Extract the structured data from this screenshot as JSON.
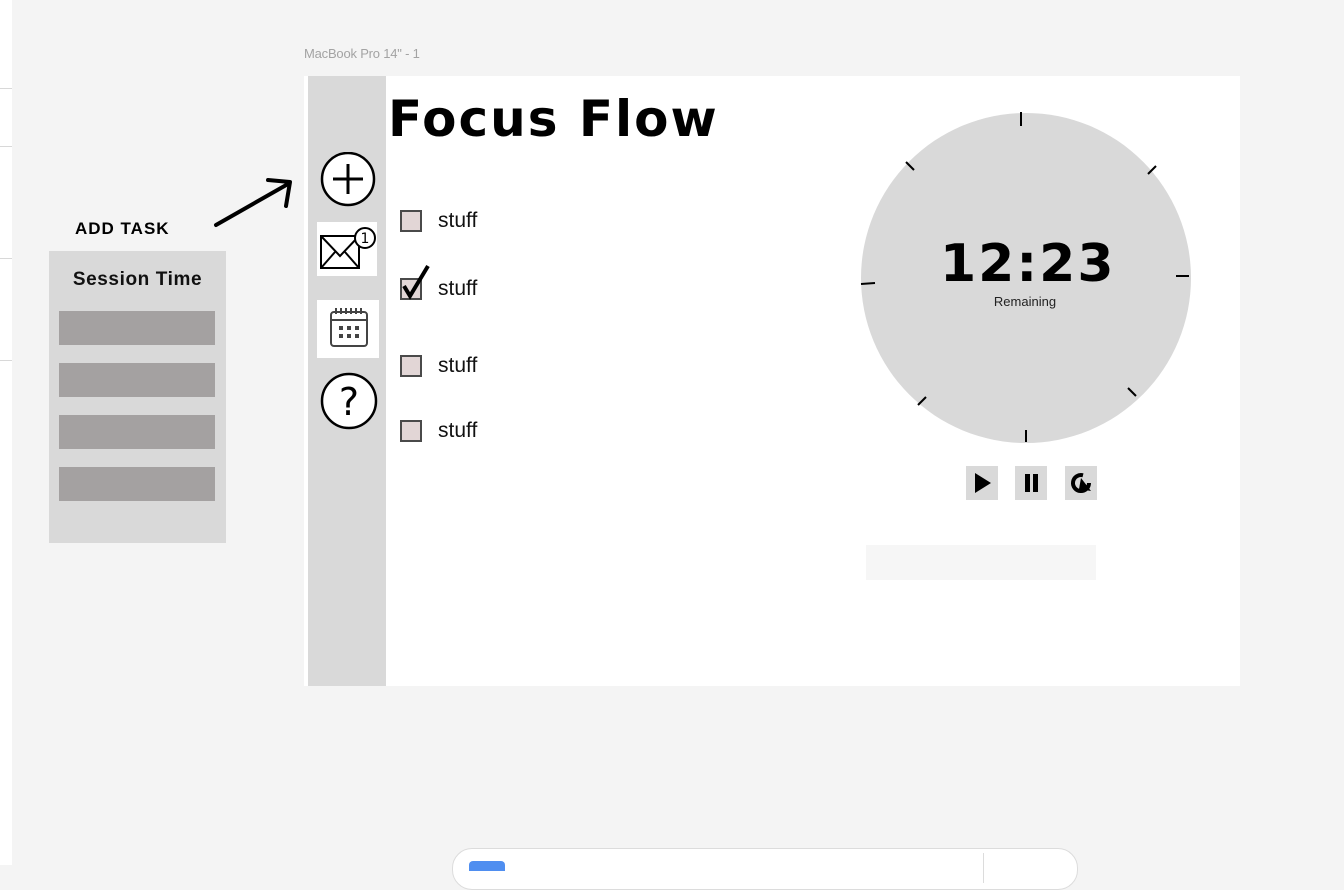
{
  "canvas": {
    "frame_label": "MacBook Pro 14\" - 1"
  },
  "app": {
    "title": "Focus Flow",
    "sidebar": [
      {
        "name": "add-task",
        "icon": "plus-circle-icon"
      },
      {
        "name": "inbox",
        "icon": "mail-icon",
        "badge": "1"
      },
      {
        "name": "calendar",
        "icon": "calendar-icon"
      },
      {
        "name": "help",
        "icon": "question-circle-icon"
      }
    ],
    "tasks": [
      {
        "label": "stuff",
        "checked": false
      },
      {
        "label": "stuff",
        "checked": true
      },
      {
        "label": "stuff",
        "checked": false
      },
      {
        "label": "stuff",
        "checked": false
      }
    ],
    "timer": {
      "time": "12:23",
      "subtitle": "Remaining",
      "controls": [
        "play-icon",
        "pause-icon",
        "restart-icon"
      ]
    }
  },
  "annotations": {
    "add_task": "ADD TASK"
  },
  "session_panel": {
    "title": "Session Time",
    "slots": 4
  },
  "colors": {
    "sidebar": "#d9d9d9",
    "slot": "#a4a1a1",
    "checkbox": "#e2d6d6",
    "timer_face": "#d9d9d9",
    "badge_accent": "#4f8ef0"
  }
}
